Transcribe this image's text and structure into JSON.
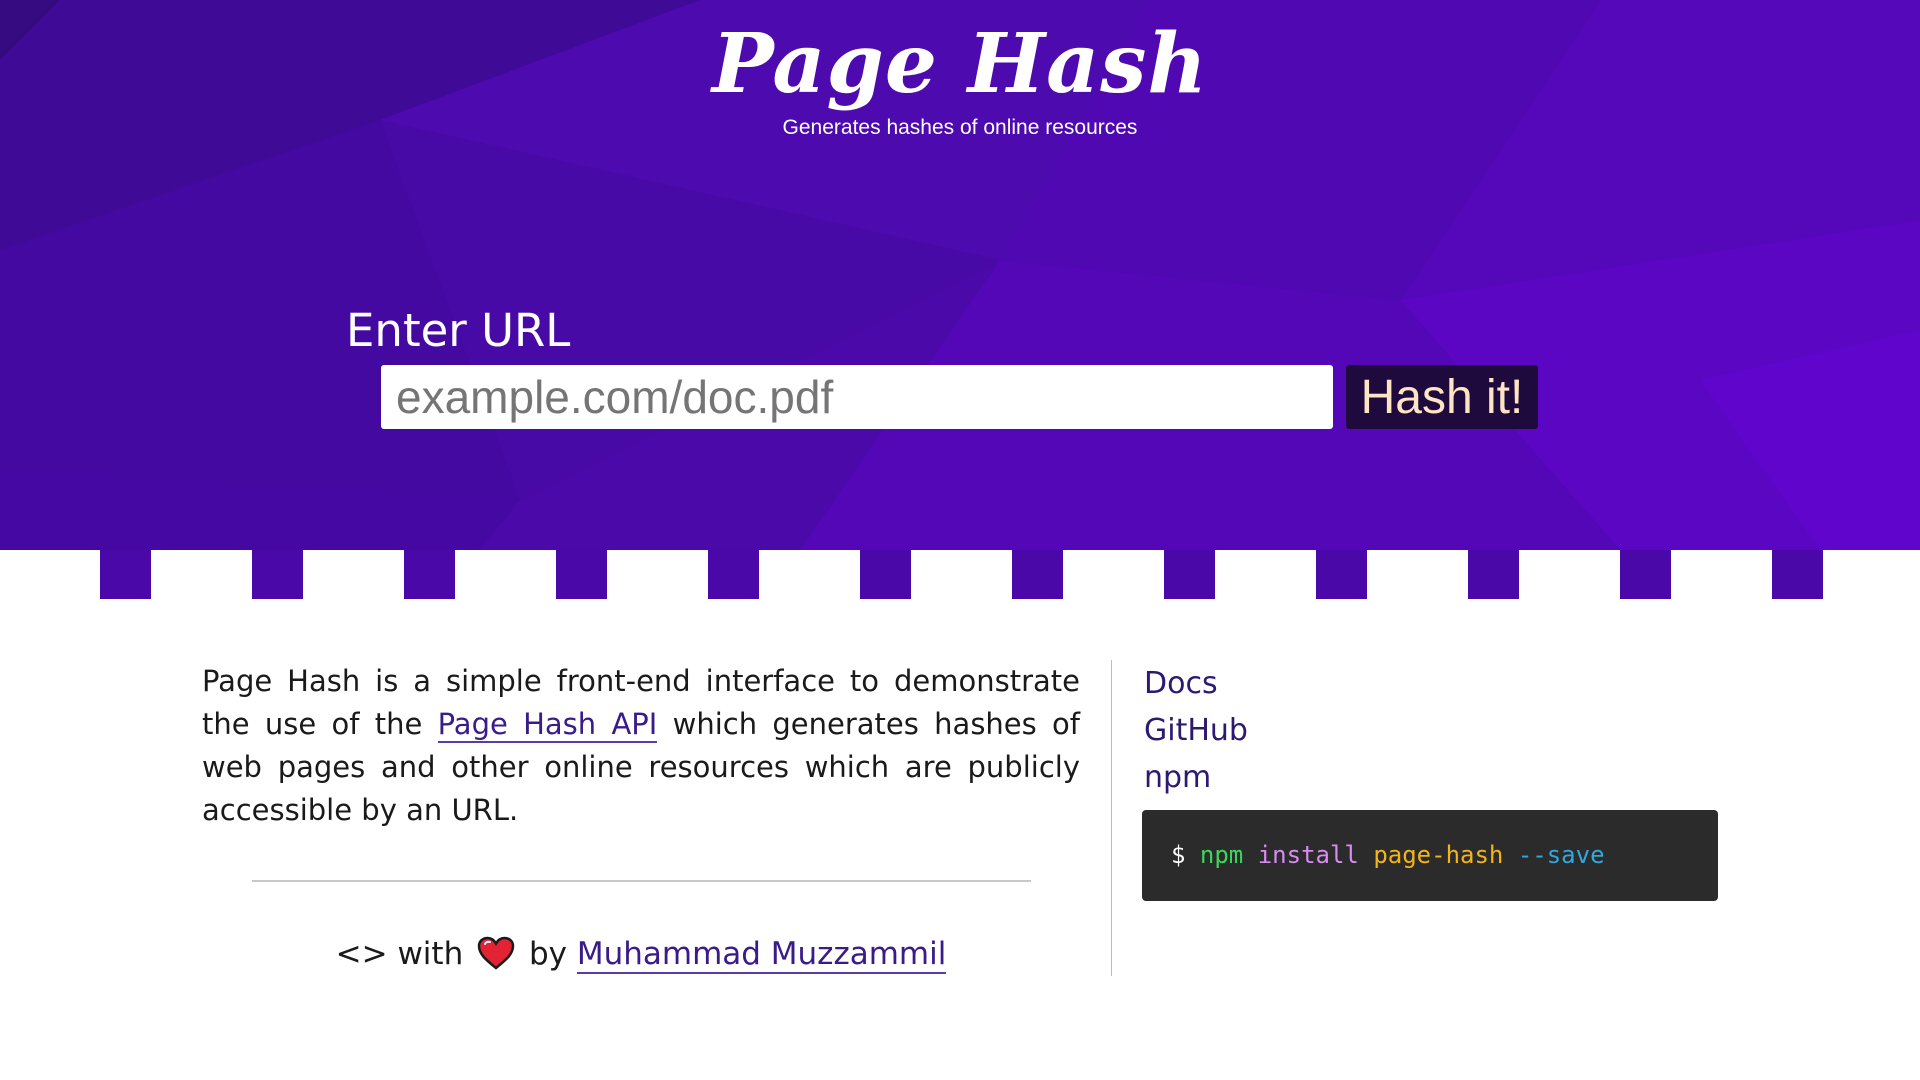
{
  "header": {
    "title": "Page Hash",
    "subtitle": "Generates hashes of online resources"
  },
  "form": {
    "label": "Enter URL",
    "placeholder": "example.com/doc.pdf",
    "value": "",
    "button_label": "Hash it!"
  },
  "about": {
    "text_before": "Page Hash is a simple front-end interface to demonstrate the use of the ",
    "api_link": "Page Hash API",
    "text_after": " which generates hashes of web pages and other online resources which are publicly accessible by an URL."
  },
  "credit": {
    "prefix": "<> with",
    "heart_icon": "heart-icon",
    "by": "by",
    "author": "Muhammad Muzzammil"
  },
  "sidebar": {
    "links": [
      "Docs",
      "GitHub",
      "npm"
    ]
  },
  "code": {
    "dollar": "$",
    "cmd": "npm",
    "sub": "install",
    "pkg": "page-hash",
    "flag": "--save"
  },
  "colors": {
    "hero": "#4a08a8",
    "button_bg": "#1f0a3d",
    "button_text": "#fde4c2",
    "link": "#2d1a70",
    "code_bg": "#2b2b2b"
  }
}
